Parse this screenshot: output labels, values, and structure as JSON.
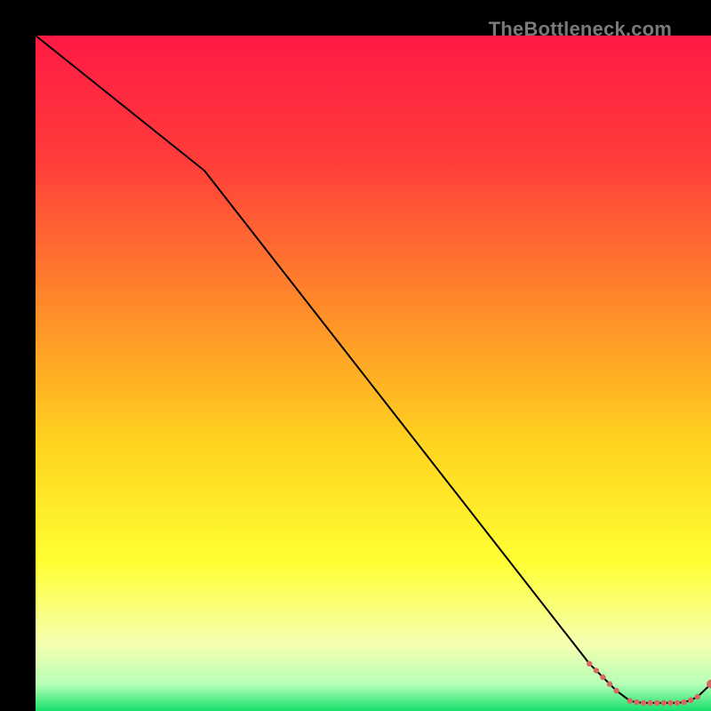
{
  "watermark": "TheBottleneck.com",
  "chart_data": {
    "type": "line",
    "title": "",
    "xlabel": "",
    "ylabel": "",
    "xlim": [
      0,
      100
    ],
    "ylim": [
      0,
      100
    ],
    "grid": false,
    "series": [
      {
        "name": "bottleneck-curve",
        "x": [
          0,
          25,
          82,
          86,
          88,
          89,
          90,
          91,
          92,
          93,
          94,
          95,
          96,
          97,
          98,
          100
        ],
        "y": [
          100,
          80,
          7,
          3,
          1.5,
          1.3,
          1.2,
          1.2,
          1.2,
          1.2,
          1.2,
          1.2,
          1.3,
          1.6,
          2.1,
          4.0
        ]
      }
    ],
    "markers": {
      "name": "highlight-points",
      "x": [
        82,
        83,
        84,
        85,
        86,
        88,
        89,
        90,
        91,
        92,
        93,
        94,
        95,
        96,
        97,
        98,
        100
      ],
      "y": [
        7,
        6,
        5,
        4,
        3,
        1.5,
        1.3,
        1.2,
        1.2,
        1.2,
        1.2,
        1.2,
        1.2,
        1.3,
        1.6,
        2.1,
        4.0
      ]
    },
    "gradient_stops": [
      {
        "pos": 0.0,
        "color": "#ff1a44"
      },
      {
        "pos": 0.18,
        "color": "#ff3b3b"
      },
      {
        "pos": 0.4,
        "color": "#ff8a2a"
      },
      {
        "pos": 0.6,
        "color": "#ffd21f"
      },
      {
        "pos": 0.78,
        "color": "#ffff33"
      },
      {
        "pos": 0.9,
        "color": "#f6ffb0"
      },
      {
        "pos": 0.96,
        "color": "#b7ffb7"
      },
      {
        "pos": 1.0,
        "color": "#18e06b"
      }
    ],
    "style": {
      "line_color": "#000000",
      "line_width": 2,
      "marker_color": "#d66a63",
      "marker_radius_small": 3.2,
      "marker_radius_end": 5
    }
  }
}
